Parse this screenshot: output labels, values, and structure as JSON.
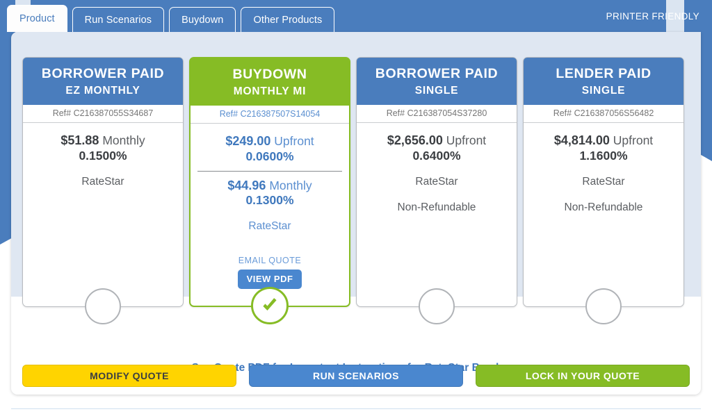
{
  "tabs": [
    {
      "label": "Product",
      "active": true
    },
    {
      "label": "Run Scenarios",
      "active": false
    },
    {
      "label": "Buydown",
      "active": false
    },
    {
      "label": "Other Products",
      "active": false
    }
  ],
  "header": {
    "printer_friendly": "PRINTER FRIENDLY"
  },
  "cards": [
    {
      "title": "BORROWER PAID",
      "subtitle": "EZ MONTHLY",
      "ref": "Ref# C216387055S34687",
      "selected": false,
      "prices": [
        {
          "amount": "$51.88",
          "term": "Monthly",
          "rate": "0.1500%"
        }
      ],
      "notes": [
        "RateStar"
      ],
      "actions": null
    },
    {
      "title": "BUYDOWN",
      "subtitle": "MONTHLY MI",
      "ref": "Ref# C216387507S14054",
      "selected": true,
      "prices": [
        {
          "amount": "$249.00",
          "term": "Upfront",
          "rate": "0.0600%"
        },
        {
          "amount": "$44.96",
          "term": "Monthly",
          "rate": "0.1300%"
        }
      ],
      "notes": [
        "RateStar"
      ],
      "actions": {
        "email_quote": "EMAIL QUOTE",
        "view_pdf": "VIEW PDF"
      }
    },
    {
      "title": "BORROWER PAID",
      "subtitle": "SINGLE",
      "ref": "Ref# C216387054S37280",
      "selected": false,
      "prices": [
        {
          "amount": "$2,656.00",
          "term": "Upfront",
          "rate": "0.6400%"
        }
      ],
      "notes": [
        "RateStar",
        "Non-Refundable"
      ],
      "actions": null
    },
    {
      "title": "LENDER PAID",
      "subtitle": "SINGLE",
      "ref": "Ref# C216387056S56482",
      "selected": false,
      "prices": [
        {
          "amount": "$4,814.00",
          "term": "Upfront",
          "rate": "1.1600%"
        }
      ],
      "notes": [
        "RateStar",
        "Non-Refundable"
      ],
      "actions": null
    }
  ],
  "footer": {
    "note": "See Quote PDF for Important Instructions for RateStar Buydown",
    "buttons": [
      {
        "label": "MODIFY QUOTE",
        "style": "yellow"
      },
      {
        "label": "RUN SCENARIOS",
        "style": "blue"
      },
      {
        "label": "LOCK IN YOUR QUOTE",
        "style": "green"
      }
    ]
  },
  "colors": {
    "brand_blue": "#4a7dbd",
    "accent_green": "#86bc25",
    "accent_yellow": "#ffd400",
    "link_blue": "#3f78bd",
    "panel_bg": "#dfe7f2"
  },
  "icons": {
    "check": "check-icon"
  }
}
